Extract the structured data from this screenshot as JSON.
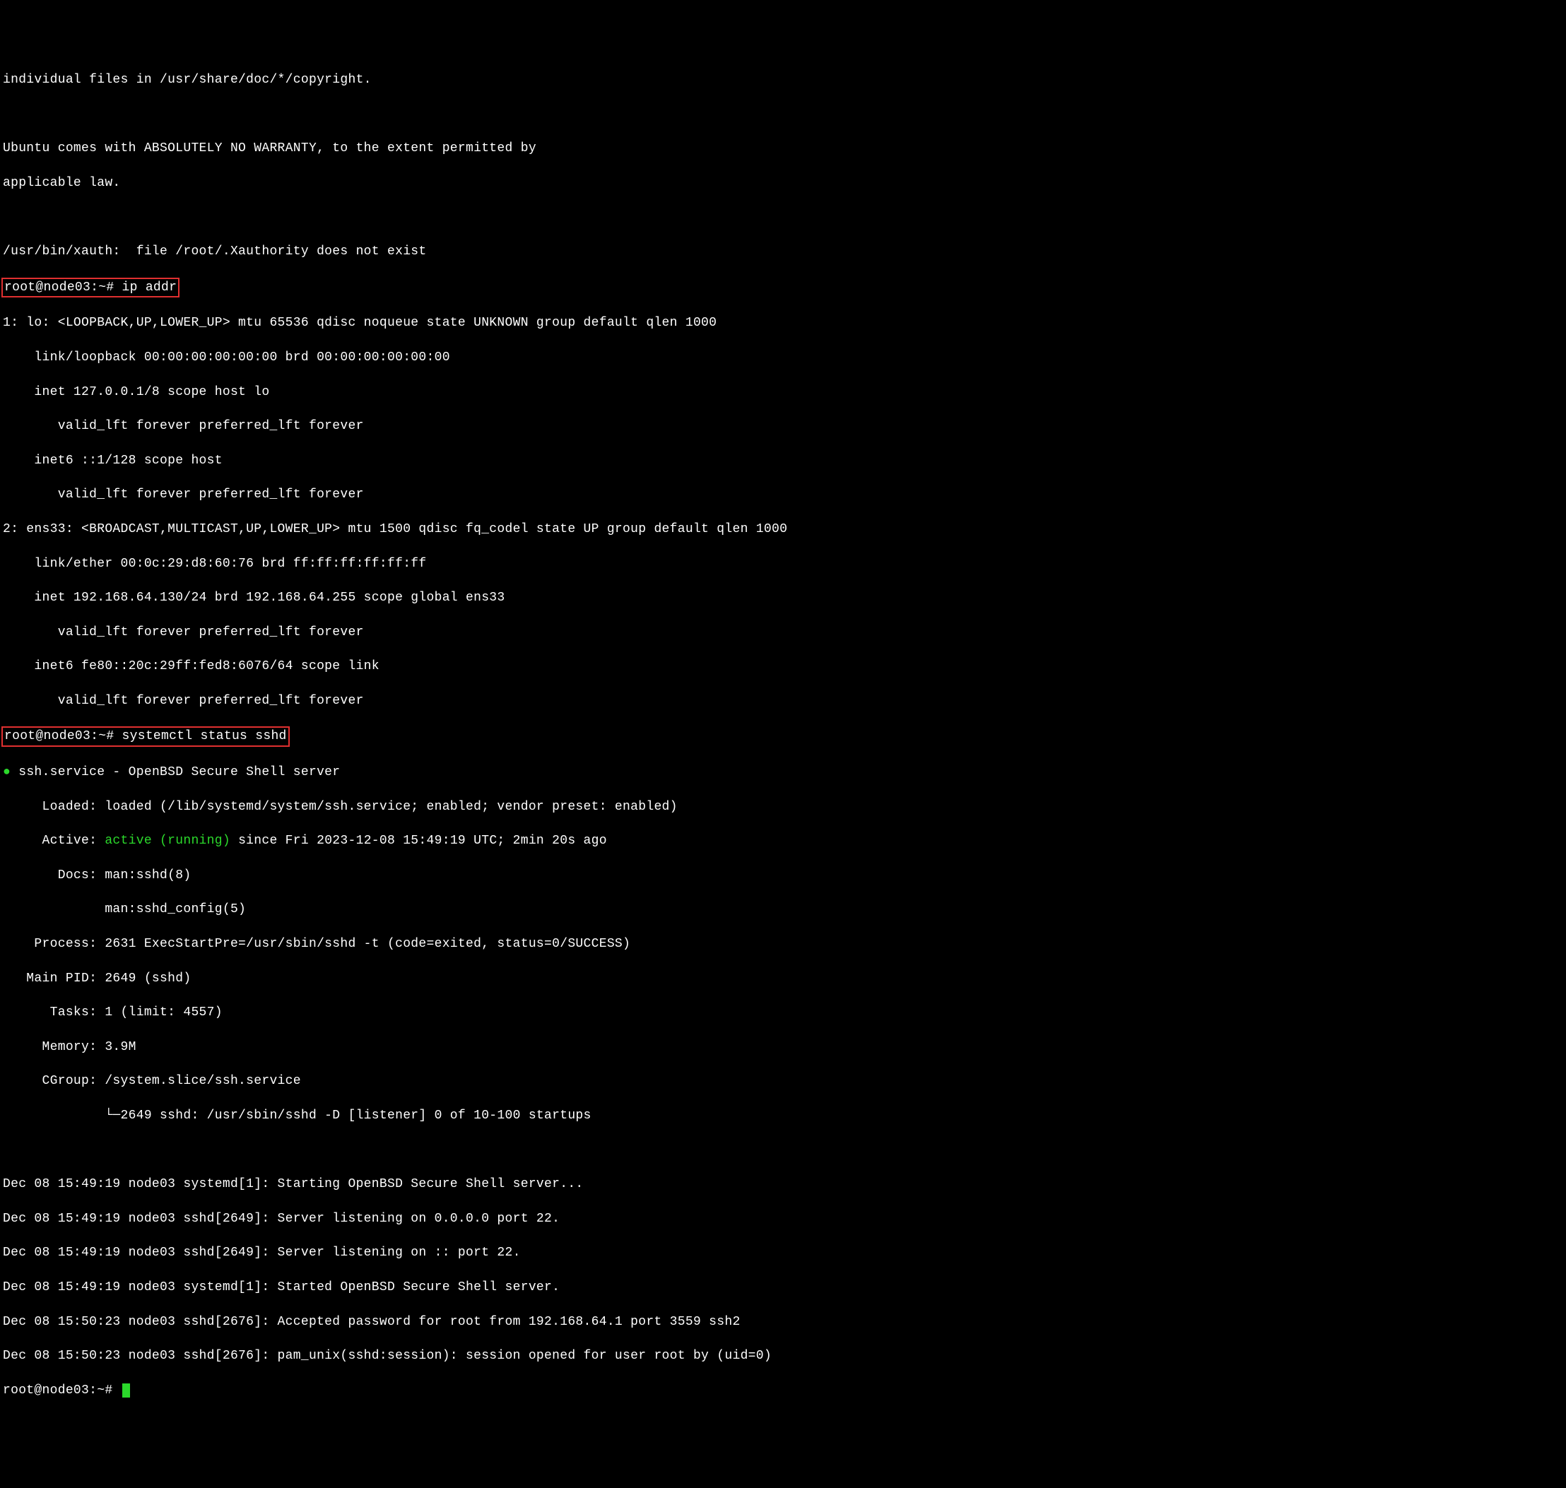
{
  "motd": {
    "l1": "individual files in /usr/share/doc/*/copyright.",
    "l2": "Ubuntu comes with ABSOLUTELY NO WARRANTY, to the extent permitted by",
    "l3": "applicable law."
  },
  "xauth": "/usr/bin/xauth:  file /root/.Xauthority does not exist",
  "prompt1": "root@node03:~# ip addr",
  "ipaddr": {
    "lo_head": "1: lo: <LOOPBACK,UP,LOWER_UP> mtu 65536 qdisc noqueue state UNKNOWN group default qlen 1000",
    "lo_link": "    link/loopback 00:00:00:00:00:00 brd 00:00:00:00:00:00",
    "lo_inet": "    inet 127.0.0.1/8 scope host lo",
    "lo_valid1": "       valid_lft forever preferred_lft forever",
    "lo_inet6": "    inet6 ::1/128 scope host",
    "lo_valid2": "       valid_lft forever preferred_lft forever",
    "ens_head": "2: ens33: <BROADCAST,MULTICAST,UP,LOWER_UP> mtu 1500 qdisc fq_codel state UP group default qlen 1000",
    "ens_link": "    link/ether 00:0c:29:d8:60:76 brd ff:ff:ff:ff:ff:ff",
    "ens_inet": "    inet 192.168.64.130/24 brd 192.168.64.255 scope global ens33",
    "ens_valid1": "       valid_lft forever preferred_lft forever",
    "ens_inet6": "    inet6 fe80::20c:29ff:fed8:6076/64 scope link",
    "ens_valid2": "       valid_lft forever preferred_lft forever"
  },
  "prompt2": "root@node03:~# systemctl status sshd",
  "systemctl": {
    "bullet": "●",
    "service_line": " ssh.service - OpenBSD Secure Shell server",
    "loaded": "     Loaded: loaded (/lib/systemd/system/ssh.service; enabled; vendor preset: enabled)",
    "active_label": "     Active: ",
    "active_value": "active (running)",
    "active_rest": " since Fri 2023-12-08 15:49:19 UTC; 2min 20s ago",
    "docs1": "       Docs: man:sshd(8)",
    "docs2": "             man:sshd_config(5)",
    "process": "    Process: 2631 ExecStartPre=/usr/sbin/sshd -t (code=exited, status=0/SUCCESS)",
    "mainpid": "   Main PID: 2649 (sshd)",
    "tasks": "      Tasks: 1 (limit: 4557)",
    "memory": "     Memory: 3.9M",
    "cgroup": "     CGroup: /system.slice/ssh.service",
    "cgroup_tree": "             └─2649 sshd: /usr/sbin/sshd -D [listener] 0 of 10-100 startups",
    "log1": "Dec 08 15:49:19 node03 systemd[1]: Starting OpenBSD Secure Shell server...",
    "log2": "Dec 08 15:49:19 node03 sshd[2649]: Server listening on 0.0.0.0 port 22.",
    "log3": "Dec 08 15:49:19 node03 sshd[2649]: Server listening on :: port 22.",
    "log4": "Dec 08 15:49:19 node03 systemd[1]: Started OpenBSD Secure Shell server.",
    "log5": "Dec 08 15:50:23 node03 sshd[2676]: Accepted password for root from 192.168.64.1 port 3559 ssh2",
    "log6": "Dec 08 15:50:23 node03 sshd[2676]: pam_unix(sshd:session): session opened for user root by (uid=0)"
  },
  "prompt3": "root@node03:~# "
}
